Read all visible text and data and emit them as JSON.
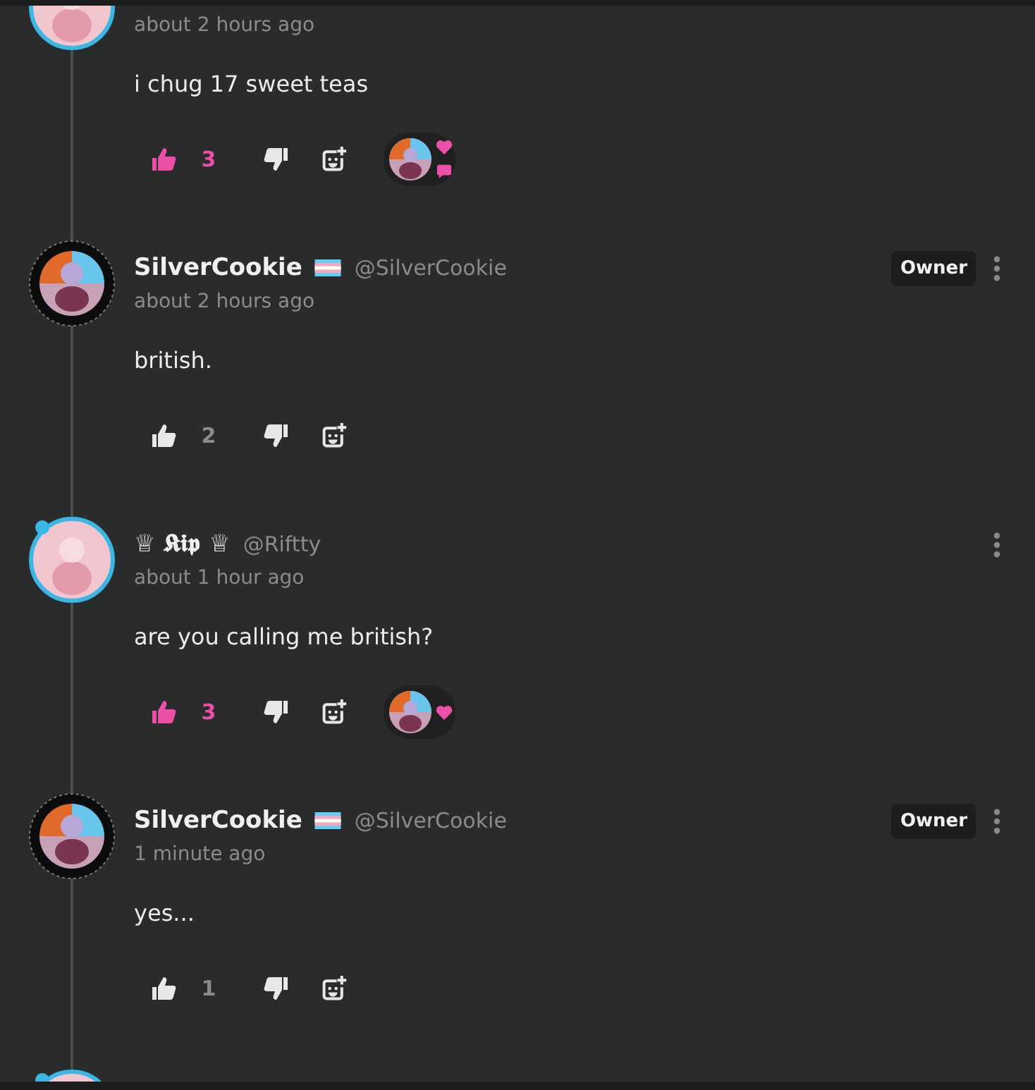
{
  "comments": [
    {
      "avatar": {
        "kind": "ring"
      },
      "time": "about 2 hours ago",
      "body": "i chug 17 sweet teas",
      "liked": true,
      "likes": "3",
      "reactors": [
        {
          "badges": [
            {
              "kind": "heart"
            },
            {
              "kind": "comment"
            }
          ]
        }
      ]
    },
    {
      "avatar": {
        "kind": "spiky"
      },
      "name": "SilverCookie",
      "pride_flag": true,
      "handle": "@SilverCookie",
      "owner_badge": "Owner",
      "time": "about 2 hours ago",
      "body": "british.",
      "liked": false,
      "likes": "2"
    },
    {
      "avatar": {
        "kind": "ring"
      },
      "name": "♕ 𝕶𝖎𝖕 ♕",
      "pride_flag": false,
      "handle": "@Riftty",
      "time": "about 1 hour ago",
      "body": "are you calling me british?",
      "liked": true,
      "likes": "3",
      "reactors": [
        {
          "badges": [
            {
              "kind": "heart"
            }
          ]
        }
      ]
    },
    {
      "avatar": {
        "kind": "spiky"
      },
      "name": "SilverCookie",
      "pride_flag": true,
      "handle": "@SilverCookie",
      "owner_badge": "Owner",
      "time": "1 minute ago",
      "body": "yes...",
      "liked": false,
      "likes": "1"
    },
    {
      "avatar": {
        "kind": "ring"
      }
    }
  ]
}
